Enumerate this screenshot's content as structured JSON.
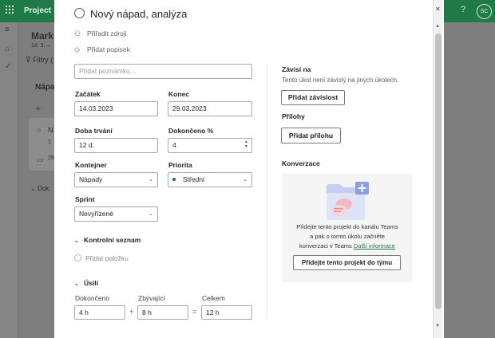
{
  "app": {
    "name": "Project",
    "user_initials": "SC",
    "help_icon": "help-icon"
  },
  "background": {
    "plan_title": "Mark",
    "plan_dates": "14. 3. –",
    "filter_label": "Filtry (",
    "bucket_title": "Nápa",
    "add_label": "+",
    "card_task_prefix": "N",
    "card_sub_prefix": "1",
    "card_date_prefix": "29",
    "completed_prefix": "Dok"
  },
  "task": {
    "title": "Nový nápad, analýza",
    "assign_label": "Přiřadit zdroji",
    "tag_label": "Přidat popisek",
    "notes_placeholder": "Přidat poznámku..."
  },
  "fields": {
    "start": {
      "label": "Začátek",
      "value": "14.03.2023"
    },
    "end": {
      "label": "Konec",
      "value": "29.03.2023"
    },
    "duration": {
      "label": "Doba trvání",
      "value": "12 d."
    },
    "percent": {
      "label": "Dokončeno %",
      "value": "4"
    },
    "bucket": {
      "label": "Kontejner",
      "value": "Nápady"
    },
    "priority": {
      "label": "Priorita",
      "value": "Střední",
      "color": "#1e7a46"
    },
    "sprint": {
      "label": "Sprint",
      "value": "Nevyřízené"
    }
  },
  "checklist": {
    "label": "Kontrolní seznam",
    "add_placeholder": "Přidat položku"
  },
  "effort": {
    "label": "Úsilí",
    "completed_label": "Dokončeno",
    "completed_value": "4 h",
    "remaining_label": "Zbývající",
    "remaining_value": "8 h",
    "total_label": "Celkem",
    "total_value": "12 h",
    "plus": "+",
    "equals": "="
  },
  "dependencies": {
    "label": "Závisí na",
    "text": "Tento úkol není závislý na jiných úkolech.",
    "button": "Přidat závislost"
  },
  "attachments": {
    "label": "Přílohy",
    "button": "Přidat přílohu"
  },
  "conversation": {
    "label": "Konverzace",
    "text_line1": "Přidejte tento projekt do kanálu Teams",
    "text_line2": "a pak o tomto úkolu začněte",
    "text_line3": "konverzaci v Teams",
    "link": "Další informace",
    "button": "Přidejte tento projekt do týmu"
  },
  "colors": {
    "brand": "#1e7a46",
    "accent_illustration": "#8c9eea"
  }
}
